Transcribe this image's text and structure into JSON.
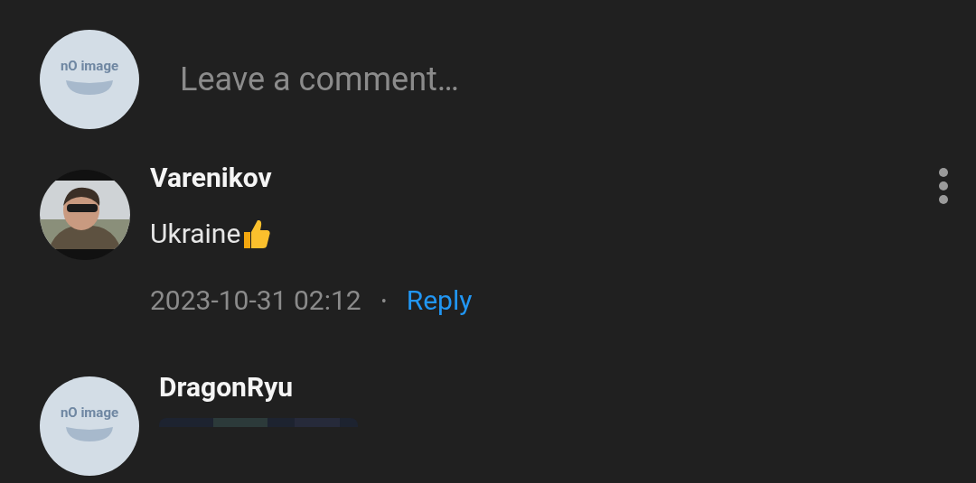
{
  "composer": {
    "avatar_text": "nO image",
    "placeholder": "Leave a comment…"
  },
  "comments": [
    {
      "author": "Varenikov",
      "text": "Ukraine",
      "reaction_emoji": true,
      "date": "2023-10-31 02:12",
      "separator": "•",
      "reply": "Reply",
      "has_menu": true
    },
    {
      "author": "DragonRyu",
      "avatar": {
        "kind": "placeholder",
        "text": "nO image"
      }
    }
  ]
}
